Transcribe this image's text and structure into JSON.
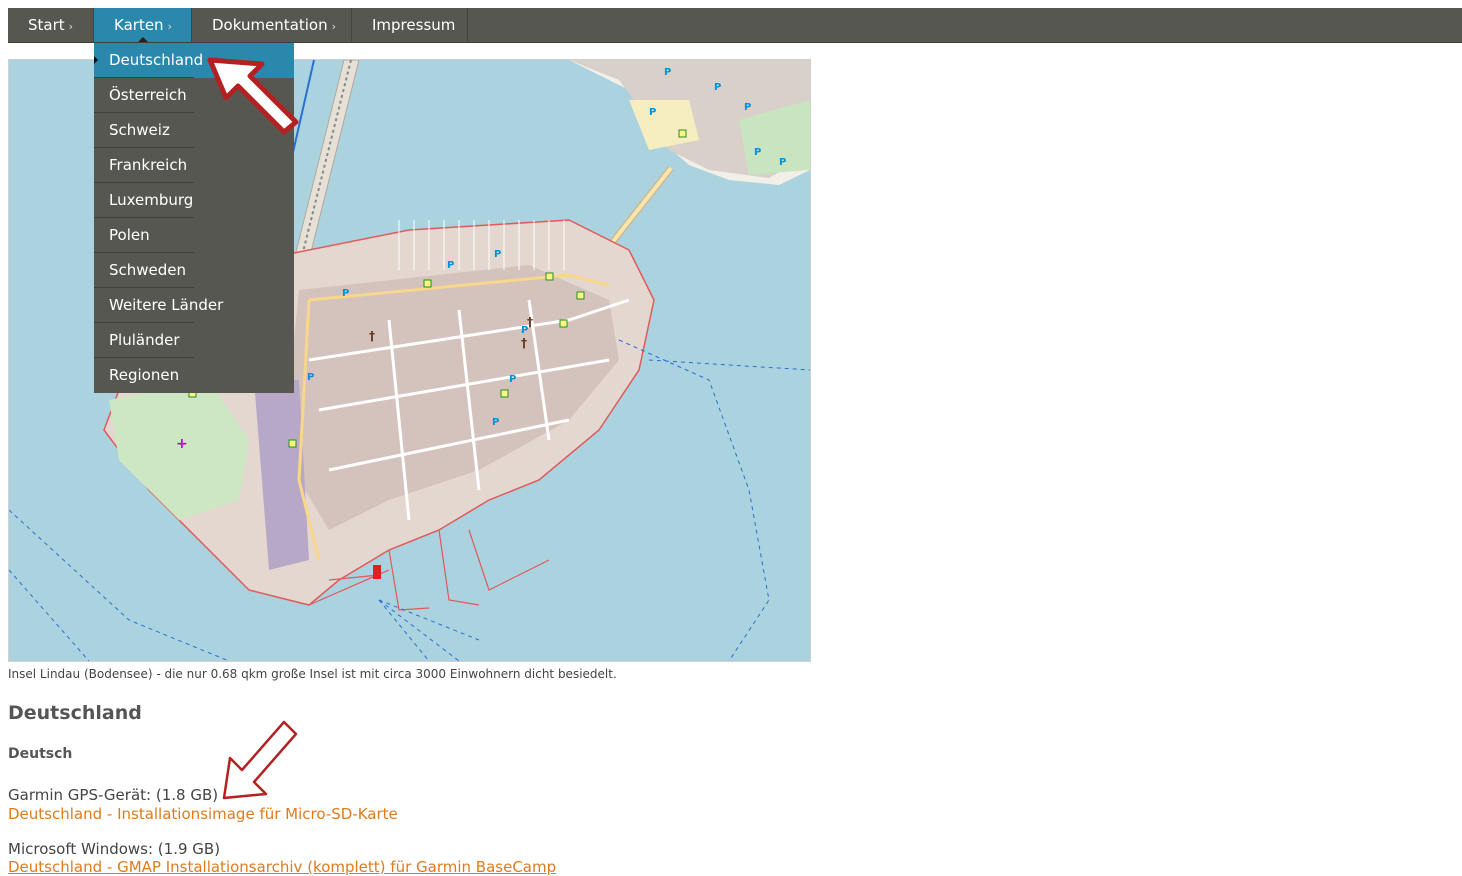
{
  "nav": {
    "items": [
      {
        "label": "Start",
        "chevron": "›"
      },
      {
        "label": "Karten",
        "chevron": "›",
        "active": true
      },
      {
        "label": "Dokumentation",
        "chevron": "›"
      },
      {
        "label": "Impressum",
        "chevron": ""
      }
    ]
  },
  "dropdown": {
    "items": [
      {
        "label": "Deutschland",
        "active": true
      },
      {
        "label": "Österreich"
      },
      {
        "label": "Schweiz"
      },
      {
        "label": "Frankreich"
      },
      {
        "label": "Luxemburg"
      },
      {
        "label": "Polen"
      },
      {
        "label": "Schweden"
      },
      {
        "label": "Weitere Länder"
      },
      {
        "label": "Pluländer"
      },
      {
        "label": "Regionen"
      }
    ]
  },
  "map": {
    "caption": "Insel Lindau (Bodensee) - die nur 0.68 qkm große Insel ist mit circa 3000 Einwohnern dicht besiedelt."
  },
  "content": {
    "heading": "Deutschland",
    "subheading": "Deutsch",
    "downloads": [
      {
        "label": "Garmin GPS-Gerät: (1.8 GB)",
        "link": "Deutschland - Installationsimage für Micro-SD-Karte"
      },
      {
        "label": "Microsoft Windows: (1.9 GB)",
        "link": "Deutschland - GMAP Installationsarchiv (komplett) für Garmin BaseCamp"
      }
    ]
  },
  "colors": {
    "nav_bg": "#575752",
    "active": "#2a88ad",
    "link": "#e07a1b",
    "water": "#aad3df",
    "arrow": "#b22222"
  }
}
